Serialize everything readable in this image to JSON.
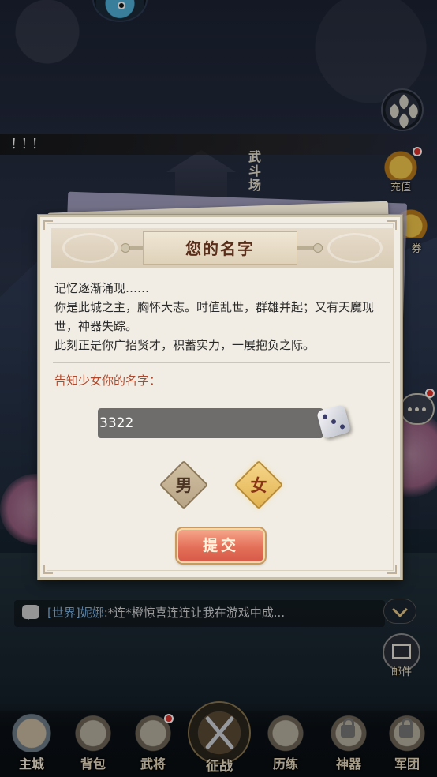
{
  "notice": {
    "text": "!!!"
  },
  "scene": {
    "building_label": "武斗场"
  },
  "side_icons": {
    "recharge_label": "充值",
    "coupon_label": "券"
  },
  "dialog": {
    "title": "您的名字",
    "story_lines": [
      "记忆逐渐涌现……",
      "你是此城之主，胸怀大志。时值乱世，群雄并起；又有天魔现世，神器失踪。",
      "此刻正是你广招贤才，积蓄实力，一展抱负之际。"
    ],
    "prompt": "告知少女你的名字：",
    "name_value": "3322",
    "gender_male": "男",
    "gender_female": "女",
    "selected_gender": "女",
    "submit_label": "提交"
  },
  "chat": {
    "channel": "[世界]",
    "user": "妮娜",
    "message": ":*连*橙惊喜连连让我在游戏中成..."
  },
  "mail": {
    "label": "邮件"
  },
  "bottom_nav": {
    "items": [
      {
        "label": "主城"
      },
      {
        "label": "背包"
      },
      {
        "label": "武将"
      },
      {
        "label": "征战"
      },
      {
        "label": "历练"
      },
      {
        "label": "神器"
      },
      {
        "label": "军团"
      }
    ]
  },
  "colors": {
    "accent_red": "#e0322b",
    "submit_button": "#e4705a",
    "prompt_text": "#b0492b",
    "chat_channel": "#7fb6e6"
  }
}
